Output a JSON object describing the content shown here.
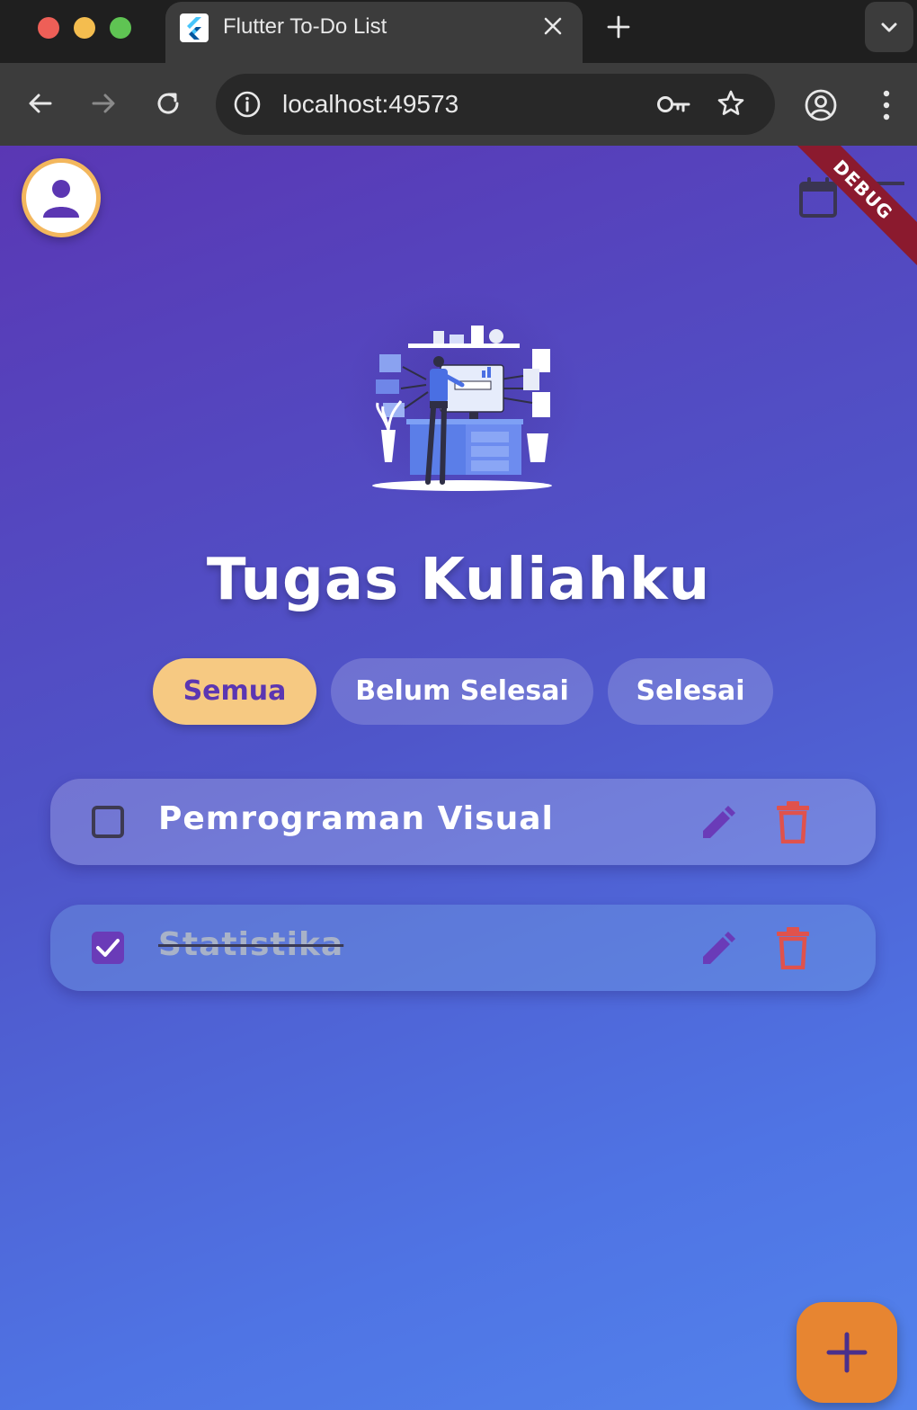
{
  "browser": {
    "tab_title": "Flutter To-Do List",
    "url": "localhost:49573",
    "icons": [
      "back-arrow-icon",
      "forward-arrow-icon",
      "reload-icon",
      "site-info-icon",
      "key-icon",
      "star-icon",
      "profile-icon",
      "more-menu-icon"
    ]
  },
  "app": {
    "debug_banner": "DEBUG",
    "title": "Tugas Kuliahku",
    "filters": [
      {
        "label": "Semua",
        "selected": true
      },
      {
        "label": "Belum Selesai",
        "selected": false
      },
      {
        "label": "Selesai",
        "selected": false
      }
    ],
    "tasks": [
      {
        "title": "Pemrograman Visual",
        "completed": false
      },
      {
        "title": "Statistika",
        "completed": true
      }
    ],
    "colors": {
      "accent": "#f6c982",
      "fab": "#e78531",
      "delete": "#e0524c",
      "edit": "#6a3bb8"
    }
  }
}
